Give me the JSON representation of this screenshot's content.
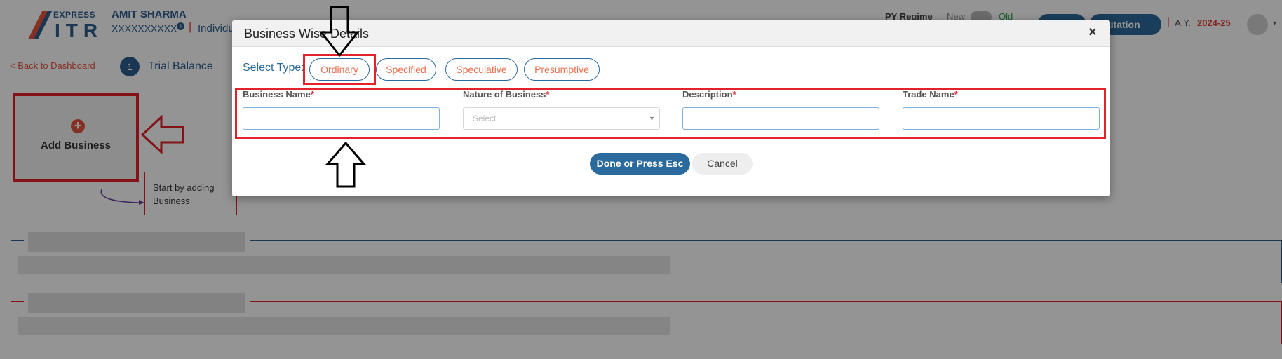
{
  "header": {
    "brand_express": "EXPRESS",
    "brand_itr": "ITR",
    "user_name": "AMIT SHARMA",
    "user_pan": "XXXXXXXXXX",
    "user_type": "Individu",
    "regime_label": "PY Regime",
    "regime_new": "New",
    "regime_old": "Old",
    "computation_button": "mputation",
    "ay_separator": "|",
    "ay_label": "A.Y.",
    "ay_value": "2024-25"
  },
  "nav": {
    "back_link": "< Back to Dashboard",
    "step_number": "1",
    "step_label": "Trial Balance"
  },
  "add_business": {
    "plus": "+",
    "label": "Add Business",
    "tooltip": "Start by adding Business"
  },
  "modal": {
    "title": "Business Wise Details",
    "close": "×",
    "select_type_label": "Select Type:",
    "types": [
      "Ordinary",
      "Specified",
      "Speculative",
      "Presumptive"
    ],
    "fields": [
      {
        "label": "Business Name",
        "required": "*"
      },
      {
        "label": "Nature of Business",
        "required": "*",
        "placeholder": "Select"
      },
      {
        "label": "Description",
        "required": "*"
      },
      {
        "label": "Trade Name",
        "required": "*"
      }
    ],
    "done_button": "Done or Press Esc",
    "cancel_button": "Cancel"
  },
  "colors": {
    "brand_blue": "#2b6a9c",
    "accent_red": "#e4222a",
    "type_text": "#e8704f"
  }
}
